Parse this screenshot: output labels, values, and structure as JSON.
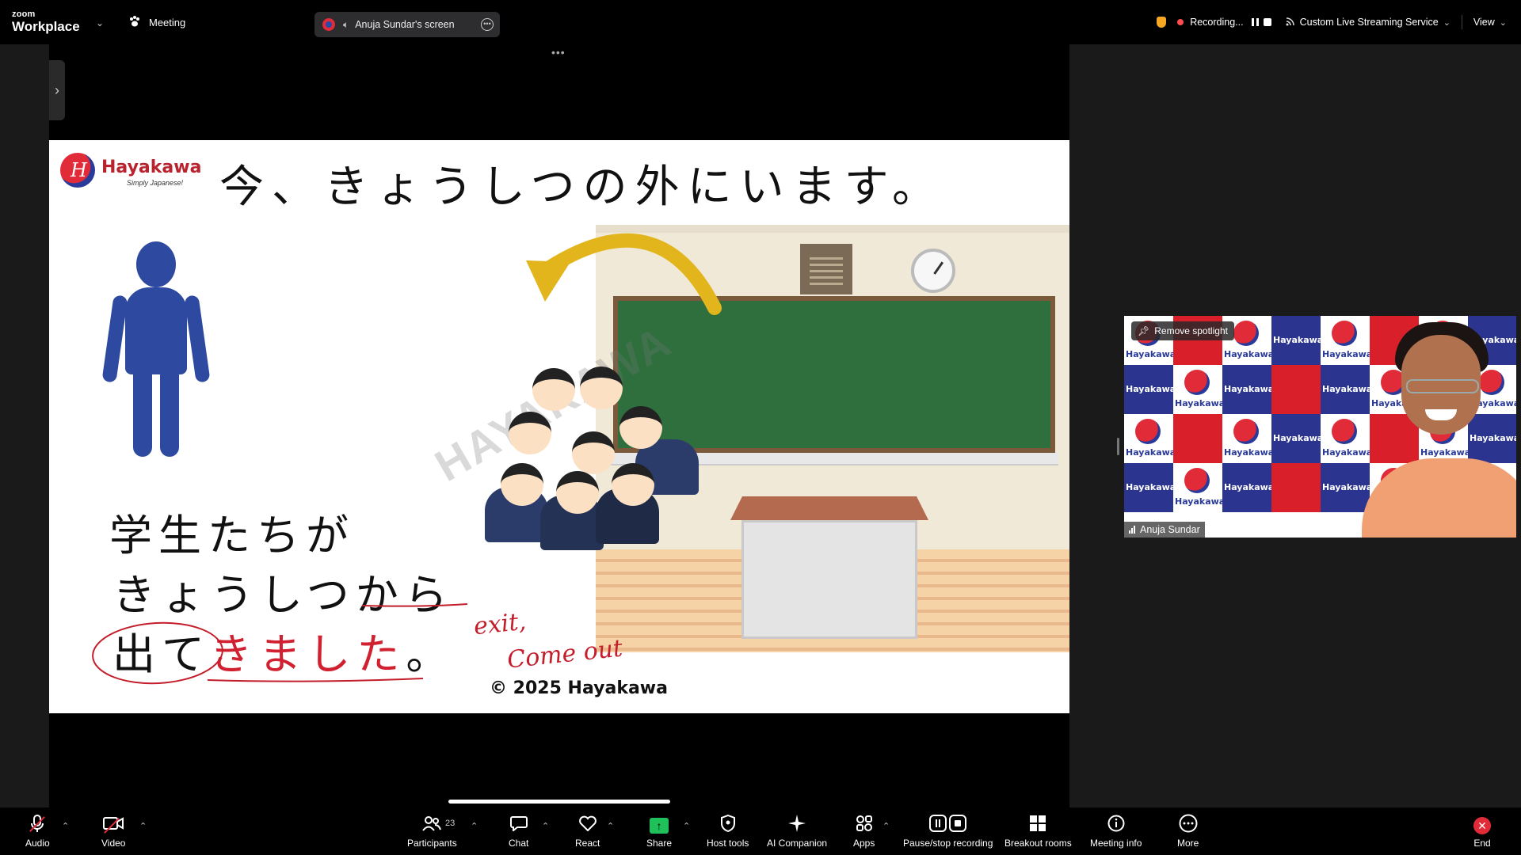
{
  "topbar": {
    "brand_small": "zoom",
    "brand_big": "Workplace",
    "meeting_label": "Meeting",
    "share_label": "Anuja Sundar's screen",
    "recording_label": "Recording...",
    "streaming_label": "Custom Live Streaming Service",
    "view_label": "View"
  },
  "slide": {
    "logo_name": "Hayakawa",
    "logo_tagline": "Simply Japanese!",
    "title": "今、きょうしつの外にいます。",
    "line1": "学生たちが",
    "line2": "きょうしつから",
    "line3a": "出て",
    "line3b": "きました",
    "line3c": "。",
    "hand_note_1": "exit,",
    "hand_note_2": "Come out",
    "watermark": "HAYAKAWA",
    "copyright": "© 2025 Hayakawa"
  },
  "participant": {
    "name": "Anuja Sundar",
    "spotlight_label": "Remove spotlight"
  },
  "toolbar": {
    "audio": "Audio",
    "video": "Video",
    "participants": "Participants",
    "participant_count": "23",
    "chat": "Chat",
    "react": "React",
    "share": "Share",
    "host_tools": "Host tools",
    "ai_companion": "AI Companion",
    "apps": "Apps",
    "pause_recording": "Pause/stop recording",
    "breakout_rooms": "Breakout rooms",
    "meeting_info": "Meeting info",
    "more": "More",
    "end": "End"
  },
  "colors": {
    "brand_red": "#d12030",
    "brand_blue": "#2b3590",
    "board_green": "#2f6f3d",
    "share_green": "#1fbf5a"
  }
}
